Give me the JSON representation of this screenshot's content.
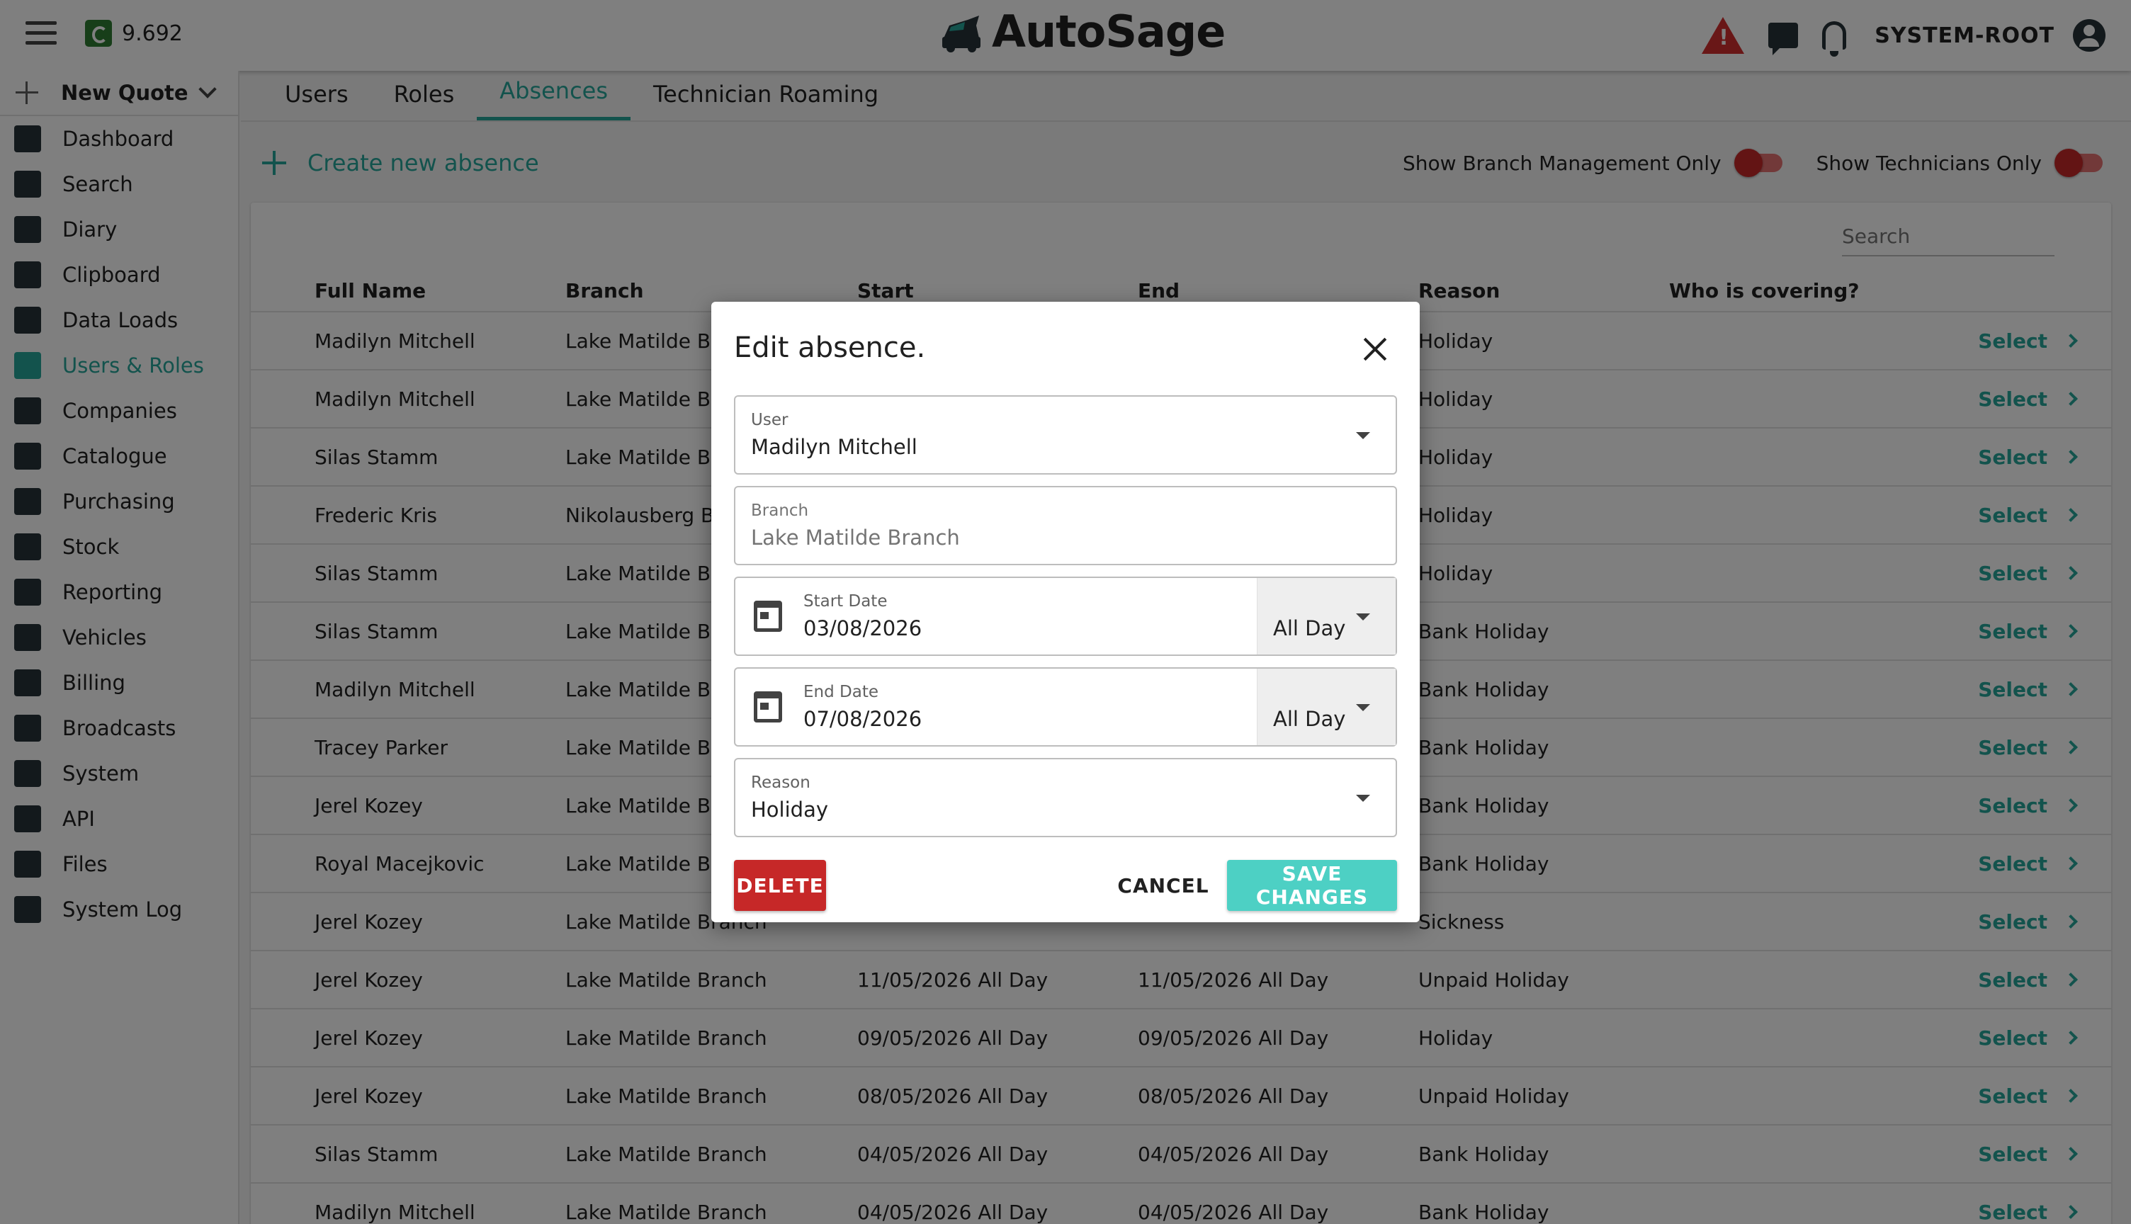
{
  "header": {
    "credits": "9.692",
    "app_name": "AutoSage",
    "username": "SYSTEM-ROOT"
  },
  "sidebar": {
    "new_quote": "New Quote",
    "items": [
      {
        "label": "Dashboard",
        "icon": "dashboard-icon"
      },
      {
        "label": "Search",
        "icon": "search-icon"
      },
      {
        "label": "Diary",
        "icon": "calendar-icon"
      },
      {
        "label": "Clipboard",
        "icon": "clipboard-icon"
      },
      {
        "label": "Data Loads",
        "icon": "upload-icon"
      },
      {
        "label": "Users & Roles",
        "icon": "users-icon",
        "active": true
      },
      {
        "label": "Companies",
        "icon": "building-icon"
      },
      {
        "label": "Catalogue",
        "icon": "book-icon"
      },
      {
        "label": "Purchasing",
        "icon": "receipt-icon"
      },
      {
        "label": "Stock",
        "icon": "location-pin-icon"
      },
      {
        "label": "Reporting",
        "icon": "bar-chart-icon"
      },
      {
        "label": "Vehicles",
        "icon": "car-icon"
      },
      {
        "label": "Billing",
        "icon": "invoice-icon"
      },
      {
        "label": "Broadcasts",
        "icon": "megaphone-icon"
      },
      {
        "label": "System",
        "icon": "gear-icon"
      },
      {
        "label": "API",
        "icon": "code-icon"
      },
      {
        "label": "Files",
        "icon": "folder-icon"
      },
      {
        "label": "System Log",
        "icon": "document-icon"
      }
    ]
  },
  "tabs": [
    {
      "label": "Users"
    },
    {
      "label": "Roles"
    },
    {
      "label": "Absences",
      "active": true
    },
    {
      "label": "Technician Roaming"
    }
  ],
  "actions": {
    "create_label": "Create new absence",
    "toggle_branch": "Show Branch Management Only",
    "toggle_technicians": "Show Technicians Only"
  },
  "search": {
    "placeholder": "Search"
  },
  "table": {
    "headers": [
      "Full Name",
      "Branch",
      "Start",
      "End",
      "Reason",
      "Who is covering?"
    ],
    "select_label": "Select",
    "rows": [
      {
        "name": "Madilyn Mitchell",
        "branch": "Lake Matilde Br",
        "start": "",
        "end": "",
        "reason": "Holiday"
      },
      {
        "name": "Madilyn Mitchell",
        "branch": "Lake Matilde Br",
        "start": "",
        "end": "",
        "reason": "Holiday"
      },
      {
        "name": "Silas Stamm",
        "branch": "Lake Matilde Br",
        "start": "",
        "end": "",
        "reason": "Holiday"
      },
      {
        "name": "Frederic Kris",
        "branch": "Nikolausberg Br",
        "start": "",
        "end": "",
        "reason": "Holiday"
      },
      {
        "name": "Silas Stamm",
        "branch": "Lake Matilde Br",
        "start": "",
        "end": "",
        "reason": "Holiday"
      },
      {
        "name": "Silas Stamm",
        "branch": "Lake Matilde Br",
        "start": "",
        "end": "",
        "reason": "Bank Holiday"
      },
      {
        "name": "Madilyn Mitchell",
        "branch": "Lake Matilde Br",
        "start": "",
        "end": "",
        "reason": "Bank Holiday"
      },
      {
        "name": "Tracey Parker",
        "branch": "Lake Matilde Br",
        "start": "",
        "end": "",
        "reason": "Bank Holiday"
      },
      {
        "name": "Jerel Kozey",
        "branch": "Lake Matilde Br",
        "start": "",
        "end": "",
        "reason": "Bank Holiday"
      },
      {
        "name": "Royal Macejkovic",
        "branch": "Lake Matilde Br",
        "start": "",
        "end": "",
        "reason": "Bank Holiday"
      },
      {
        "name": "Jerel Kozey",
        "branch": "Lake Matilde Branch",
        "start": "",
        "end": "",
        "reason": "Sickness"
      },
      {
        "name": "Jerel Kozey",
        "branch": "Lake Matilde Branch",
        "start": "11/05/2026 All Day",
        "end": "11/05/2026 All Day",
        "reason": "Unpaid Holiday"
      },
      {
        "name": "Jerel Kozey",
        "branch": "Lake Matilde Branch",
        "start": "09/05/2026 All Day",
        "end": "09/05/2026 All Day",
        "reason": "Holiday"
      },
      {
        "name": "Jerel Kozey",
        "branch": "Lake Matilde Branch",
        "start": "08/05/2026 All Day",
        "end": "08/05/2026 All Day",
        "reason": "Unpaid Holiday"
      },
      {
        "name": "Silas Stamm",
        "branch": "Lake Matilde Branch",
        "start": "04/05/2026 All Day",
        "end": "04/05/2026 All Day",
        "reason": "Bank Holiday"
      },
      {
        "name": "Madilyn Mitchell",
        "branch": "Lake Matilde Branch",
        "start": "04/05/2026 All Day",
        "end": "04/05/2026 All Day",
        "reason": "Bank Holiday"
      }
    ]
  },
  "dialog": {
    "title": "Edit absence.",
    "user_label": "User",
    "user_value": "Madilyn Mitchell",
    "branch_label": "Branch",
    "branch_value": "Lake Matilde Branch",
    "start_label": "Start Date",
    "start_value": "03/08/2026",
    "start_period": "All Day",
    "end_label": "End Date",
    "end_value": "07/08/2026",
    "end_period": "All Day",
    "reason_label": "Reason",
    "reason_value": "Holiday",
    "delete_label": "DELETE",
    "cancel_label": "CANCEL",
    "save_label": "SAVE CHANGES"
  },
  "colors": {
    "accent": "#26a69a",
    "danger": "#c62828",
    "save_button": "#4dd0c4"
  }
}
